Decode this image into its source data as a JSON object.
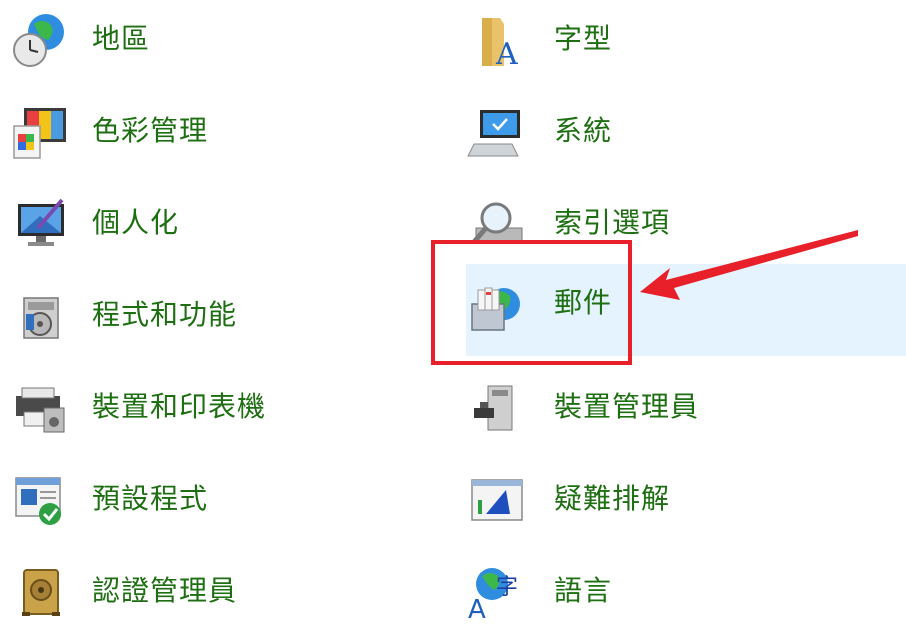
{
  "left_column": [
    {
      "label": "地區",
      "icon": "region-clock-globe-icon"
    },
    {
      "label": "色彩管理",
      "icon": "color-management-icon"
    },
    {
      "label": "個人化",
      "icon": "personalization-icon"
    },
    {
      "label": "程式和功能",
      "icon": "programs-features-icon"
    },
    {
      "label": "裝置和印表機",
      "icon": "devices-printers-icon"
    },
    {
      "label": "預設程式",
      "icon": "default-programs-icon"
    },
    {
      "label": "認證管理員",
      "icon": "credential-manager-icon"
    }
  ],
  "right_column": [
    {
      "label": "字型",
      "icon": "fonts-folder-icon"
    },
    {
      "label": "系統",
      "icon": "system-computer-icon"
    },
    {
      "label": "索引選項",
      "icon": "indexing-options-icon"
    },
    {
      "label": "郵件",
      "icon": "mail-icon",
      "hovered": true
    },
    {
      "label": "裝置管理員",
      "icon": "device-manager-icon"
    },
    {
      "label": "疑難排解",
      "icon": "troubleshooting-icon"
    },
    {
      "label": "語言",
      "icon": "language-icon"
    }
  ],
  "colors": {
    "label_text": "#1e6e12",
    "hover_background": "#e5f3ff",
    "annotation_red": "#e8202a"
  }
}
